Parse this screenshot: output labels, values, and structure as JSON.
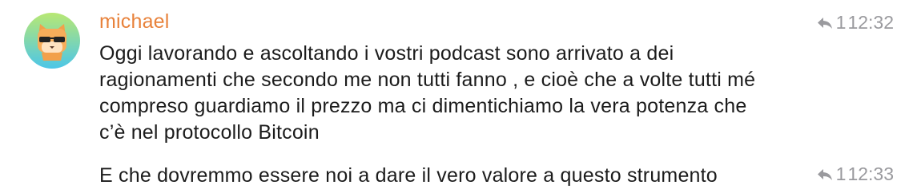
{
  "messages": [
    {
      "sender": "michael",
      "text_lines": [
        "Oggi lavorando e ascoltando i vostri podcast sono arrivato a dei",
        "ragionamenti che secondo me non tutti fanno , e cioè che a volte tutti mé",
        "compreso guardiamo il prezzo ma ci dimentichiamo la vera potenza che",
        "c’è nel protocollo Bitcoin"
      ],
      "reply_count": "1",
      "time": "12:32"
    },
    {
      "text": "E che dovremmo essere noi a dare il vero valore a questo strumento",
      "reply_count": "1",
      "time": "12:33"
    }
  ],
  "colors": {
    "sender": "#e8823b",
    "meta": "#9a9a9e",
    "avatar_gradient_top": "#b8e873",
    "avatar_gradient_bottom": "#4cc6e8"
  },
  "icons": {
    "avatar": "cat-with-sunglasses-icon",
    "reply": "reply-arrow-icon"
  }
}
